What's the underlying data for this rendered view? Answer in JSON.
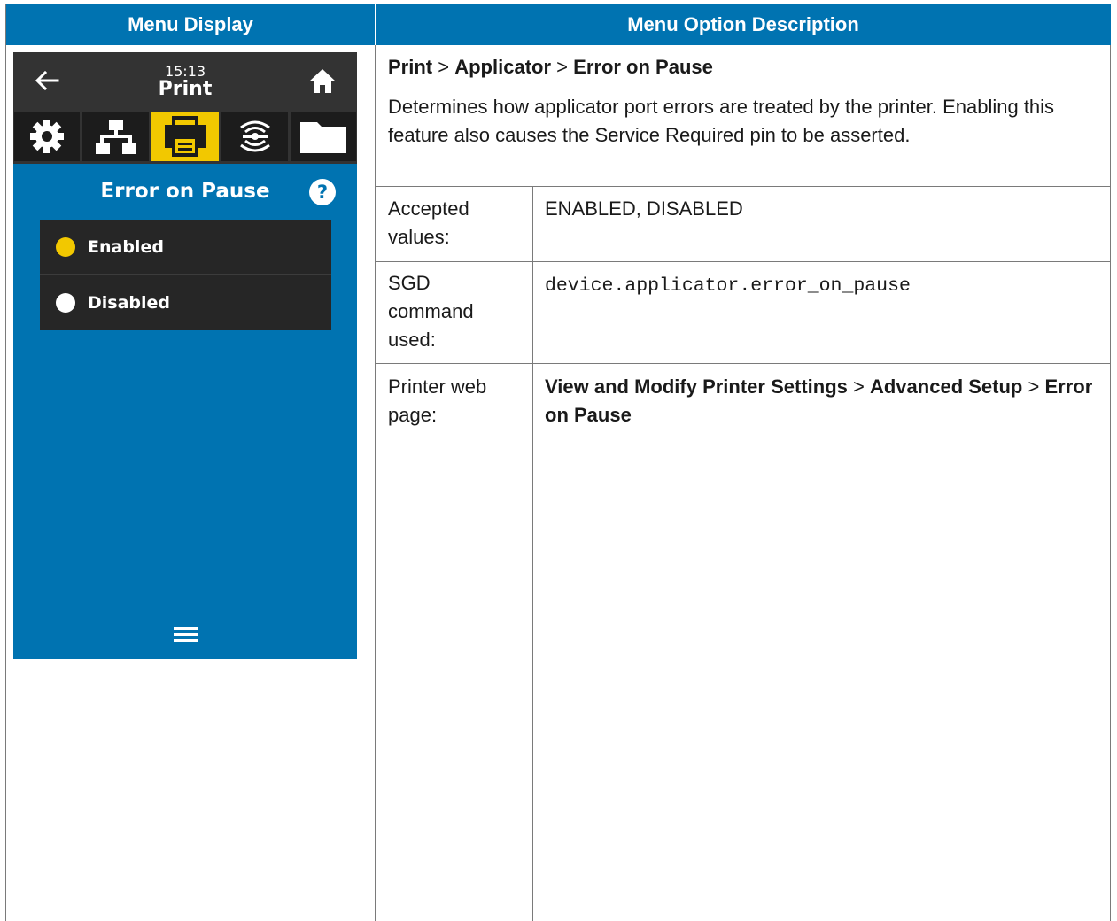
{
  "table": {
    "col1_header": "Menu Display",
    "col2_header": "Menu Option Description"
  },
  "device": {
    "time": "15:13",
    "title": "Print",
    "tabs": [
      {
        "icon": "gear-icon",
        "active": false
      },
      {
        "icon": "network-icon",
        "active": false
      },
      {
        "icon": "printer-icon",
        "active": true
      },
      {
        "icon": "wireless-icon",
        "active": false
      },
      {
        "icon": "folder-icon",
        "active": false
      }
    ],
    "panel_title": "Error on Pause",
    "options": [
      {
        "label": "Enabled",
        "selected": true
      },
      {
        "label": "Disabled",
        "selected": false
      }
    ],
    "colors": {
      "accent": "#f2c800",
      "background": "#0073b1",
      "bar": "#333333"
    }
  },
  "description": {
    "path": {
      "p1": "Print",
      "sep": ">",
      "p2": "Applicator",
      "p3": "Error on Pause"
    },
    "text": "Determines how applicator port errors are treated by the printer. Enabling this feature also causes the Service Required pin to be asserted.",
    "rows": {
      "accepted_label": "Accepted values:",
      "accepted_value": "ENABLED, DISABLED",
      "sgd_label": "SGD command used:",
      "sgd_value": "device.applicator.error_on_pause",
      "web_label": "Printer web page:",
      "web_p1": "View and Modify Printer Settings",
      "web_sep": ">",
      "web_p2": "Advanced Setup",
      "web_p3": "Error on Pause"
    }
  }
}
